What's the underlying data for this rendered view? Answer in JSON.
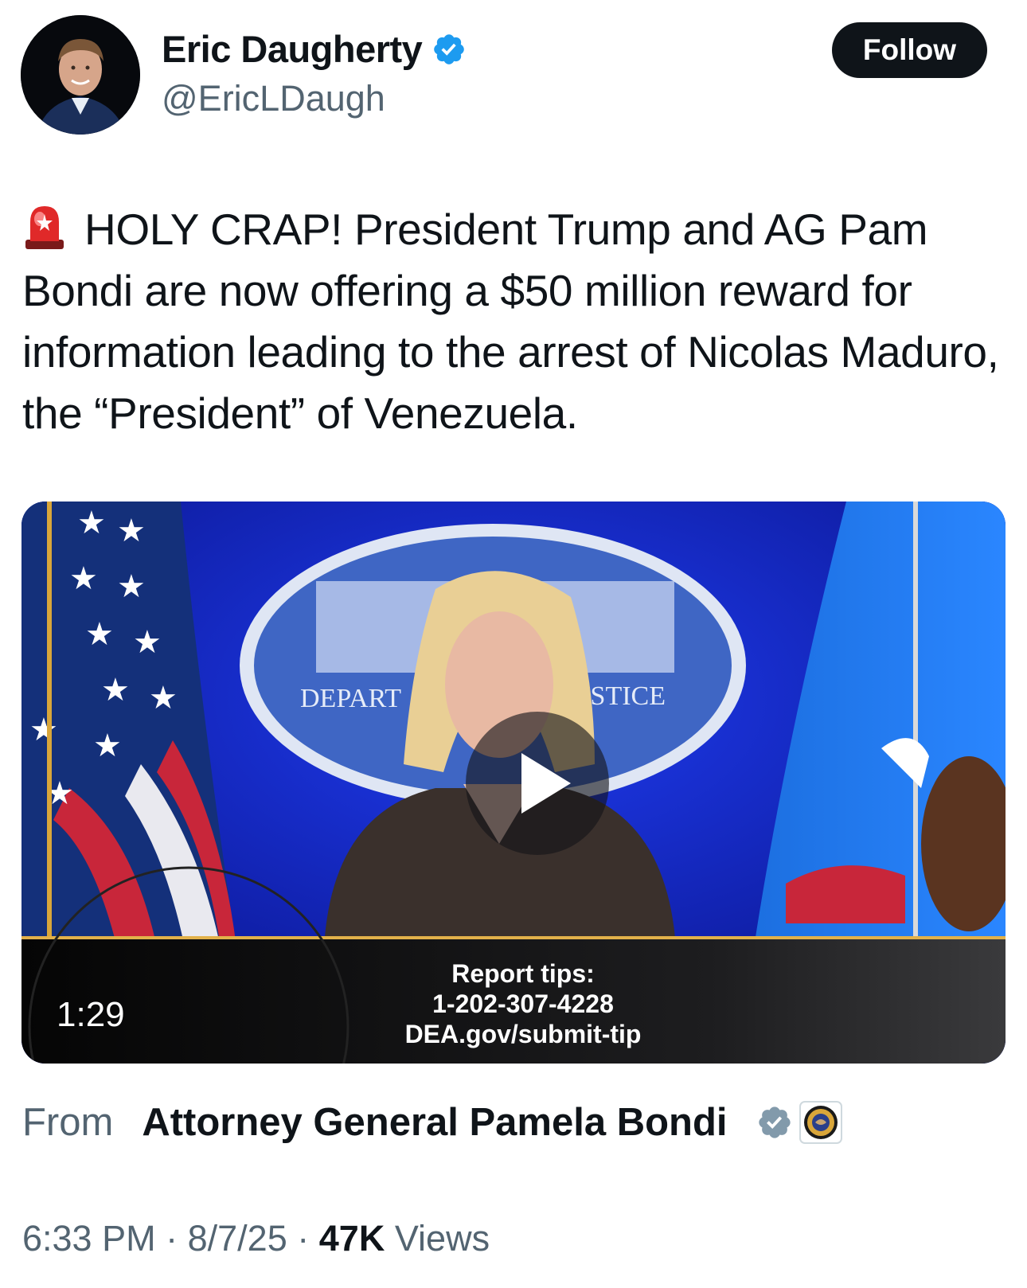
{
  "author": {
    "display_name": "Eric Daugherty",
    "handle": "@EricLDaugh",
    "verified_icon": "verified-badge-icon",
    "avatar_icon": "avatar-photo"
  },
  "follow_button": {
    "label": "Follow"
  },
  "tweet": {
    "emoji_icon": "rotating-light-emoji",
    "text": "HOLY CRAP! President Trump and AG Pam Bondi are now offering a $50 million reward for information leading to the arrest of Nicolas Maduro, the “President” of Venezuela."
  },
  "media": {
    "duration": "1:29",
    "play_icon": "play-icon",
    "seal_lettering_left": "DEPART",
    "seal_lettering_right": "USTICE",
    "caption": {
      "line1": "Report tips:",
      "line2": "1-202-307-4228",
      "line3": "DEA.gov/submit-tip"
    }
  },
  "source": {
    "from_label": "From",
    "name": "Attorney General Pamela Bondi",
    "affiliation_badge_icon": "doj-seal-icon"
  },
  "meta": {
    "time": "6:33 PM",
    "separator": "·",
    "date": "8/7/25",
    "views_count": "47K",
    "views_label": "Views"
  },
  "colors": {
    "text": "#0f1419",
    "secondary_text": "#536471",
    "verified_blue": "#1d9bf0",
    "gov_badge_gray": "#829aab"
  }
}
